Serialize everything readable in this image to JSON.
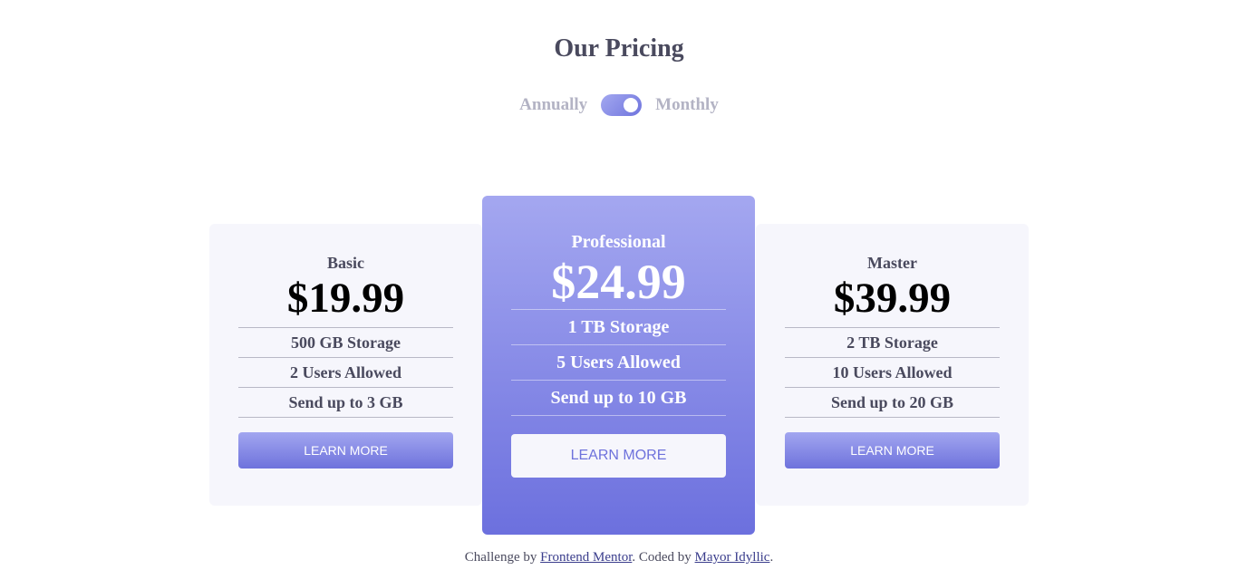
{
  "page": {
    "title": "Our Pricing"
  },
  "toggle": {
    "left_label": "Annually",
    "right_label": "Monthly",
    "state": "Monthly"
  },
  "plans": [
    {
      "name": "Basic",
      "price": "$19.99",
      "features": [
        "500 GB Storage",
        "2 Users Allowed",
        "Send up to 3 GB"
      ],
      "button": "LEARN MORE"
    },
    {
      "name": "Professional",
      "price": "$24.99",
      "features": [
        "1 TB Storage",
        "5 Users Allowed",
        "Send up to 10 GB"
      ],
      "button": "LEARN MORE"
    },
    {
      "name": "Master",
      "price": "$39.99",
      "features": [
        "2 TB Storage",
        "10 Users Allowed",
        "Send up to 20 GB"
      ],
      "button": "LEARN MORE"
    }
  ],
  "footer": {
    "prefix": "Challenge by ",
    "link1": "Frontend Mentor",
    "middle": ". Coded by ",
    "link2": "Mayor Idyllic",
    "suffix": "."
  },
  "colors": {
    "accent_light": "#a3a8f0",
    "accent_dark": "#6c70de",
    "card_bg": "#f6f6fc",
    "text": "#4a4a5e",
    "muted": "#b3b3c4"
  }
}
